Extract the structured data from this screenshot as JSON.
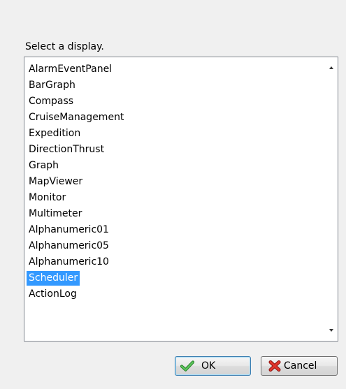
{
  "dialog": {
    "prompt": "Select a display."
  },
  "list": {
    "items": [
      "AlarmEventPanel",
      "BarGraph",
      "Compass",
      "CruiseManagement",
      "Expedition",
      "DirectionThrust",
      "Graph",
      "MapViewer",
      "Monitor",
      "Multimeter",
      "Alphanumeric01",
      "Alphanumeric05",
      "Alphanumeric10",
      "Scheduler",
      "ActionLog"
    ],
    "selected": "Scheduler"
  },
  "buttons": {
    "ok_label": "OK",
    "cancel_label": "Cancel"
  },
  "icons": {
    "ok": "checkmark-icon",
    "cancel": "red-x-icon",
    "scroll_up": "arrow-up-icon",
    "scroll_down": "arrow-down-icon"
  },
  "colors": {
    "selection": "#3399ff",
    "ok_check": "#2f9e2f",
    "cancel_x": "#d9241c"
  }
}
